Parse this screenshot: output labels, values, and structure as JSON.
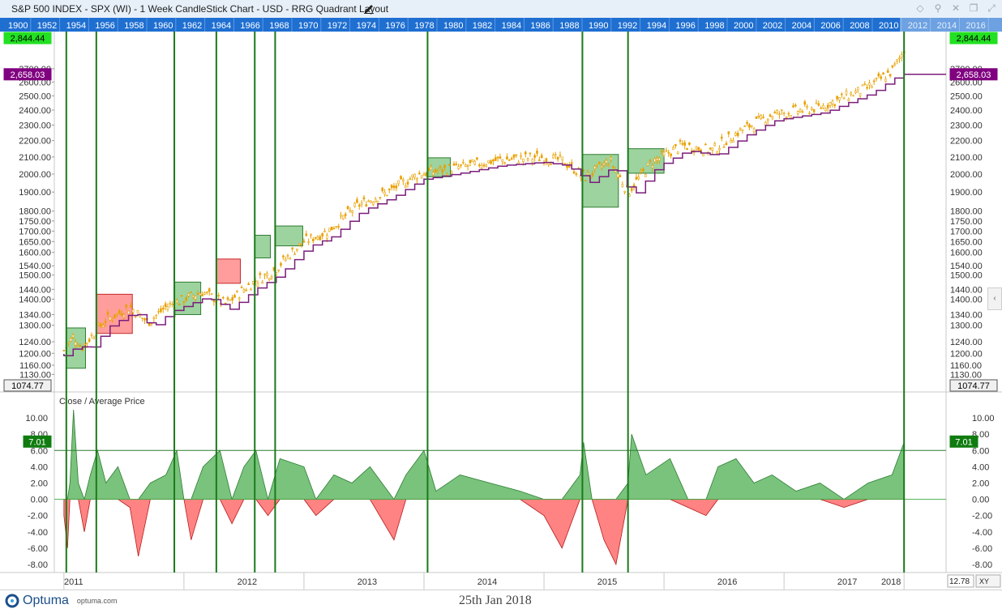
{
  "window": {
    "title": "S&P 500 INDEX - SPX (WI) - 1 Week CandleStick Chart - USD - RRG Quadrant Layout",
    "icons": [
      "pencil-icon",
      "diamond-icon",
      "pin-icon",
      "close-icon",
      "restore-icon",
      "expand-icon"
    ]
  },
  "year_band": {
    "labels": [
      "1900",
      "1952",
      "1954",
      "1956",
      "1958",
      "1960",
      "1962",
      "1964",
      "1966",
      "1968",
      "1970",
      "1972",
      "1974",
      "1976",
      "1978",
      "1980",
      "1982",
      "1984",
      "1986",
      "1988",
      "1990",
      "1992",
      "1994",
      "1996",
      "1998",
      "2000",
      "2002",
      "2004",
      "2006",
      "2008",
      "2010",
      "2012",
      "2014",
      "2016"
    ]
  },
  "colors": {
    "candle": "#e8a000",
    "average": "#7b1d7b",
    "event_line": "#1a7a1a",
    "green_box": "#4caf50",
    "red_box": "#ff3b3b",
    "positive_area": "#4caf50",
    "negative_area": "#ff5a5a",
    "last_price_bg": "#22e022",
    "avg_price_bg": "#800080",
    "osc_label_bg": "#107c10"
  },
  "chart_data": [
    {
      "type": "candlestick",
      "title": "S&P 500 INDEX - SPX (WI) - 1 Week CandleStick Chart - USD - RRG Quadrant Layout",
      "series": [
        {
          "name": "SPX weekly candles",
          "color": "#e8a000"
        },
        {
          "name": "Average Price",
          "color": "#7b1d7b"
        }
      ],
      "x_axis": {
        "labels": [
          "2011",
          "2012",
          "2013",
          "2014",
          "2015",
          "2016",
          "2017",
          "2018"
        ]
      },
      "y_axis": {
        "scale": "log",
        "range": [
          1100,
          2900
        ],
        "ticks": [
          "1130.00",
          "1160.00",
          "1200.00",
          "1240.00",
          "1300.00",
          "1340.00",
          "1400.00",
          "1440.00",
          "1500.00",
          "1540.00",
          "1600.00",
          "1650.00",
          "1700.00",
          "1750.00",
          "1800.00",
          "1900.00",
          "2000.00",
          "2100.00",
          "2200.00",
          "2300.00",
          "2400.00",
          "2500.00",
          "2600.00",
          "2700.00"
        ]
      },
      "labels": {
        "last_price": "2,844.44",
        "average_price": "2,658.03",
        "low_marker": "1074.77"
      },
      "approx_close_path": [
        {
          "x": 2011.0,
          "y": 1210
        },
        {
          "x": 2011.08,
          "y": 1260
        },
        {
          "x": 2011.15,
          "y": 1220
        },
        {
          "x": 2011.35,
          "y": 1320
        },
        {
          "x": 2011.55,
          "y": 1370
        },
        {
          "x": 2011.7,
          "y": 1310
        },
        {
          "x": 2011.85,
          "y": 1370
        },
        {
          "x": 2012.15,
          "y": 1430
        },
        {
          "x": 2012.35,
          "y": 1380
        },
        {
          "x": 2012.55,
          "y": 1460
        },
        {
          "x": 2012.75,
          "y": 1520
        },
        {
          "x": 2012.9,
          "y": 1600
        },
        {
          "x": 2013.0,
          "y": 1650
        },
        {
          "x": 2013.2,
          "y": 1700
        },
        {
          "x": 2013.45,
          "y": 1830
        },
        {
          "x": 2013.7,
          "y": 1900
        },
        {
          "x": 2013.95,
          "y": 2000
        },
        {
          "x": 2014.3,
          "y": 2040
        },
        {
          "x": 2014.6,
          "y": 2080
        },
        {
          "x": 2014.95,
          "y": 2100
        },
        {
          "x": 2015.15,
          "y": 2080
        },
        {
          "x": 2015.35,
          "y": 1980
        },
        {
          "x": 2015.55,
          "y": 2080
        },
        {
          "x": 2015.7,
          "y": 1900
        },
        {
          "x": 2015.9,
          "y": 2070
        },
        {
          "x": 2016.15,
          "y": 2170
        },
        {
          "x": 2016.4,
          "y": 2140
        },
        {
          "x": 2016.65,
          "y": 2270
        },
        {
          "x": 2016.9,
          "y": 2370
        },
        {
          "x": 2017.3,
          "y": 2420
        },
        {
          "x": 2017.7,
          "y": 2560
        },
        {
          "x": 2017.9,
          "y": 2680
        },
        {
          "x": 2018.0,
          "y": 2844
        }
      ],
      "rrg_boxes": [
        {
          "quadrant": "green",
          "x": [
            2011.02,
            2011.18
          ],
          "y": [
            1150,
            1290
          ]
        },
        {
          "quadrant": "red",
          "x": [
            2011.27,
            2011.57
          ],
          "y": [
            1270,
            1420
          ]
        },
        {
          "quadrant": "green",
          "x": [
            2011.92,
            2012.14
          ],
          "y": [
            1340,
            1470
          ]
        },
        {
          "quadrant": "red",
          "x": [
            2012.27,
            2012.47
          ],
          "y": [
            1465,
            1570
          ]
        },
        {
          "quadrant": "green",
          "x": [
            2012.59,
            2012.72
          ],
          "y": [
            1575,
            1680
          ]
        },
        {
          "quadrant": "green",
          "x": [
            2012.76,
            2012.99
          ],
          "y": [
            1630,
            1725
          ]
        },
        {
          "quadrant": "green",
          "x": [
            2014.03,
            2014.22
          ],
          "y": [
            1985,
            2095
          ]
        },
        {
          "quadrant": "green",
          "x": [
            2015.32,
            2015.62
          ],
          "y": [
            1820,
            2115
          ]
        },
        {
          "quadrant": "green",
          "x": [
            2015.7,
            2016.0
          ],
          "y": [
            2005,
            2150
          ]
        }
      ]
    },
    {
      "type": "area",
      "title": "Close / Average Price",
      "y_axis": {
        "range": [
          -8.8,
          12
        ],
        "ticks": [
          "10.00",
          "8.00",
          "6.00",
          "4.00",
          "2.00",
          "0.00",
          "-2.00",
          "-4.00",
          "-6.00",
          "-8.00"
        ]
      },
      "threshold": 6,
      "last_value_label": "7.01",
      "values_approx": [
        {
          "x": 2011.0,
          "y": -2
        },
        {
          "x": 2011.03,
          "y": -6
        },
        {
          "x": 2011.05,
          "y": 2
        },
        {
          "x": 2011.08,
          "y": 11
        },
        {
          "x": 2011.12,
          "y": 2
        },
        {
          "x": 2011.17,
          "y": -4
        },
        {
          "x": 2011.22,
          "y": 3
        },
        {
          "x": 2011.28,
          "y": 6
        },
        {
          "x": 2011.35,
          "y": 2
        },
        {
          "x": 2011.45,
          "y": 4
        },
        {
          "x": 2011.55,
          "y": -1
        },
        {
          "x": 2011.62,
          "y": -7
        },
        {
          "x": 2011.72,
          "y": 2
        },
        {
          "x": 2011.85,
          "y": 3
        },
        {
          "x": 2011.94,
          "y": 6
        },
        {
          "x": 2012.0,
          "y": 0
        },
        {
          "x": 2012.06,
          "y": -5
        },
        {
          "x": 2012.16,
          "y": 4
        },
        {
          "x": 2012.3,
          "y": 6
        },
        {
          "x": 2012.4,
          "y": -3
        },
        {
          "x": 2012.5,
          "y": 4
        },
        {
          "x": 2012.6,
          "y": 6
        },
        {
          "x": 2012.7,
          "y": -2
        },
        {
          "x": 2012.8,
          "y": 5
        },
        {
          "x": 2013.0,
          "y": 4
        },
        {
          "x": 2013.1,
          "y": -2
        },
        {
          "x": 2013.25,
          "y": 3
        },
        {
          "x": 2013.4,
          "y": 2
        },
        {
          "x": 2013.55,
          "y": 4
        },
        {
          "x": 2013.75,
          "y": -5
        },
        {
          "x": 2013.85,
          "y": 3
        },
        {
          "x": 2014.0,
          "y": 6
        },
        {
          "x": 2014.1,
          "y": 1
        },
        {
          "x": 2014.3,
          "y": 3
        },
        {
          "x": 2014.55,
          "y": 2
        },
        {
          "x": 2014.8,
          "y": 1
        },
        {
          "x": 2015.0,
          "y": -2
        },
        {
          "x": 2015.15,
          "y": -6
        },
        {
          "x": 2015.3,
          "y": 3
        },
        {
          "x": 2015.33,
          "y": 7
        },
        {
          "x": 2015.4,
          "y": 0
        },
        {
          "x": 2015.5,
          "y": -5
        },
        {
          "x": 2015.6,
          "y": -8
        },
        {
          "x": 2015.7,
          "y": 2
        },
        {
          "x": 2015.73,
          "y": 8
        },
        {
          "x": 2015.85,
          "y": 3
        },
        {
          "x": 2016.05,
          "y": 5
        },
        {
          "x": 2016.2,
          "y": -1
        },
        {
          "x": 2016.35,
          "y": -2
        },
        {
          "x": 2016.45,
          "y": 4
        },
        {
          "x": 2016.6,
          "y": 5
        },
        {
          "x": 2016.75,
          "y": 2
        },
        {
          "x": 2016.9,
          "y": 3
        },
        {
          "x": 2017.1,
          "y": 1
        },
        {
          "x": 2017.3,
          "y": 2
        },
        {
          "x": 2017.5,
          "y": -1
        },
        {
          "x": 2017.7,
          "y": 2
        },
        {
          "x": 2017.9,
          "y": 3
        },
        {
          "x": 2018.0,
          "y": 7
        }
      ]
    }
  ],
  "event_lines_x": [
    2011.02,
    2011.27,
    2011.92,
    2012.27,
    2012.59,
    2012.76,
    2014.03,
    2015.32,
    2015.7,
    2018.0
  ],
  "footer": {
    "brand": "Optuma",
    "url": "optuma.com",
    "date": "25th Jan 2018",
    "zoom": "12.78",
    "axis_mode": "XY"
  }
}
